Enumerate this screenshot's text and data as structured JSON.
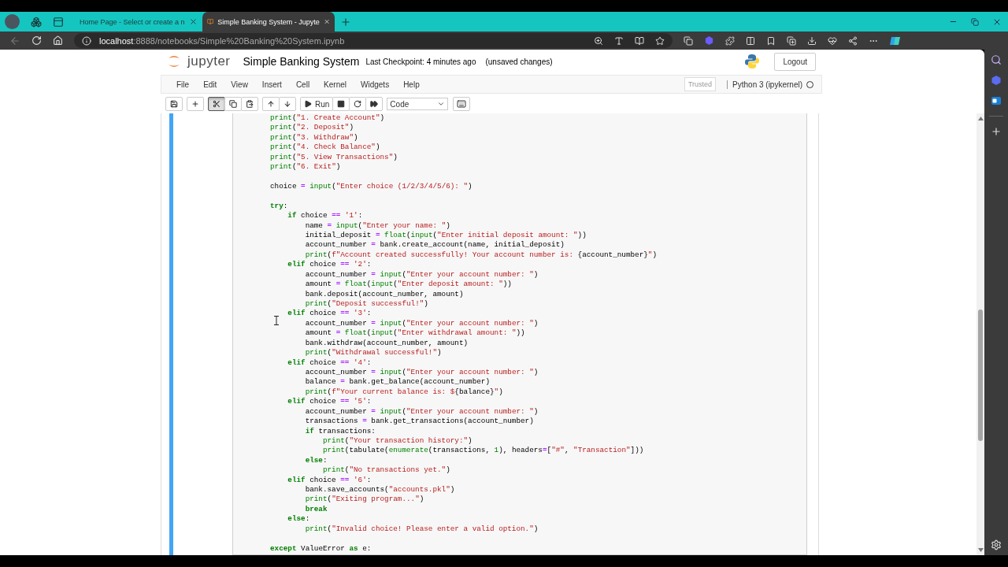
{
  "browser": {
    "tabs": [
      {
        "title": "Home Page - Select or create a n",
        "selected": false
      },
      {
        "title": "Simple Banking System - Jupyte",
        "selected": true
      }
    ],
    "url": {
      "host": "localhost",
      "path": ":8888/notebooks/Simple%20Banking%20System.ipynb"
    }
  },
  "notebook": {
    "brand": "jupyter",
    "title": "Simple Banking System",
    "checkpoint": "Last Checkpoint: 4 minutes ago",
    "status": "(unsaved changes)",
    "logout": "Logout",
    "menu": [
      "File",
      "Edit",
      "View",
      "Insert",
      "Cell",
      "Kernel",
      "Widgets",
      "Help"
    ],
    "trusted": "Trusted",
    "kernel": "Python 3 (ipykernel)",
    "kernel_busy": false,
    "toolbar": {
      "groups": [
        [
          {
            "kind": "save",
            "pressed": false
          }
        ],
        [
          {
            "kind": "add",
            "pressed": false
          }
        ],
        [
          {
            "kind": "cut",
            "pressed": true
          },
          {
            "kind": "copy",
            "pressed": false
          },
          {
            "kind": "paste",
            "pressed": false
          }
        ],
        [
          {
            "kind": "move-up",
            "pressed": false
          },
          {
            "kind": "move-down",
            "pressed": false
          }
        ],
        [
          {
            "kind": "run",
            "label": "Run",
            "pressed": false
          },
          {
            "kind": "stop",
            "pressed": false
          },
          {
            "kind": "restart",
            "pressed": false
          },
          {
            "kind": "run-all",
            "pressed": false
          }
        ]
      ],
      "cell_type": "Code",
      "after_select": [
        {
          "kind": "keyboard",
          "pressed": false
        }
      ]
    },
    "cell": {
      "selected": true,
      "lines": [
        {
          "kind": "code",
          "tokens": [
            {
              "kind": "builtin",
              "text": "print"
            },
            {
              "kind": "plain",
              "text": "("
            },
            {
              "kind": "string",
              "text": "\"1. Create Account\""
            },
            {
              "kind": "plain",
              "text": ")"
            }
          ]
        },
        {
          "kind": "code",
          "tokens": [
            {
              "kind": "builtin",
              "text": "print"
            },
            {
              "kind": "plain",
              "text": "("
            },
            {
              "kind": "string",
              "text": "\"2. Deposit\""
            },
            {
              "kind": "plain",
              "text": ")"
            }
          ]
        },
        {
          "kind": "code",
          "tokens": [
            {
              "kind": "builtin",
              "text": "print"
            },
            {
              "kind": "plain",
              "text": "("
            },
            {
              "kind": "string",
              "text": "\"3. Withdraw\""
            },
            {
              "kind": "plain",
              "text": ")"
            }
          ]
        },
        {
          "kind": "code",
          "tokens": [
            {
              "kind": "builtin",
              "text": "print"
            },
            {
              "kind": "plain",
              "text": "("
            },
            {
              "kind": "string",
              "text": "\"4. Check Balance\""
            },
            {
              "kind": "plain",
              "text": ")"
            }
          ]
        },
        {
          "kind": "code",
          "tokens": [
            {
              "kind": "builtin",
              "text": "print"
            },
            {
              "kind": "plain",
              "text": "("
            },
            {
              "kind": "string",
              "text": "\"5. View Transactions\""
            },
            {
              "kind": "plain",
              "text": ")"
            }
          ]
        },
        {
          "kind": "code",
          "tokens": [
            {
              "kind": "builtin",
              "text": "print"
            },
            {
              "kind": "plain",
              "text": "("
            },
            {
              "kind": "string",
              "text": "\"6. Exit\""
            },
            {
              "kind": "plain",
              "text": ")"
            }
          ]
        },
        {
          "kind": "blank"
        },
        {
          "kind": "code",
          "tokens": [
            {
              "kind": "plain",
              "text": "choice "
            },
            {
              "kind": "operator",
              "text": "= "
            },
            {
              "kind": "builtin",
              "text": "input"
            },
            {
              "kind": "plain",
              "text": "("
            },
            {
              "kind": "string",
              "text": "\"Enter choice (1/2/3/4/5/6): \""
            },
            {
              "kind": "plain",
              "text": ")"
            }
          ]
        },
        {
          "kind": "blank"
        },
        {
          "kind": "code",
          "tokens": [
            {
              "kind": "keyword",
              "text": "try"
            },
            {
              "kind": "plain",
              "text": ":"
            }
          ],
          "children": [
            {
              "kind": "code",
              "tokens": [
                {
                  "kind": "keyword",
                  "text": "if"
                },
                {
                  "kind": "plain",
                  "text": " choice "
                },
                {
                  "kind": "operator",
                  "text": "== "
                },
                {
                  "kind": "string",
                  "text": "'1'"
                },
                {
                  "kind": "plain",
                  "text": ":"
                }
              ],
              "children": [
                {
                  "kind": "code",
                  "tokens": [
                    {
                      "kind": "plain",
                      "text": "name "
                    },
                    {
                      "kind": "operator",
                      "text": "= "
                    },
                    {
                      "kind": "builtin",
                      "text": "input"
                    },
                    {
                      "kind": "plain",
                      "text": "("
                    },
                    {
                      "kind": "string",
                      "text": "\"Enter your name: \""
                    },
                    {
                      "kind": "plain",
                      "text": ")"
                    }
                  ]
                },
                {
                  "kind": "code",
                  "tokens": [
                    {
                      "kind": "plain",
                      "text": "initial_deposit "
                    },
                    {
                      "kind": "operator",
                      "text": "= "
                    },
                    {
                      "kind": "builtin",
                      "text": "float"
                    },
                    {
                      "kind": "plain",
                      "text": "("
                    },
                    {
                      "kind": "builtin",
                      "text": "input"
                    },
                    {
                      "kind": "plain",
                      "text": "("
                    },
                    {
                      "kind": "string",
                      "text": "\"Enter initial deposit amount: \""
                    },
                    {
                      "kind": "plain",
                      "text": "))"
                    }
                  ]
                },
                {
                  "kind": "code",
                  "tokens": [
                    {
                      "kind": "plain",
                      "text": "account_number "
                    },
                    {
                      "kind": "operator",
                      "text": "= "
                    },
                    {
                      "kind": "plain",
                      "text": "bank.create_account(name, initial_deposit)"
                    }
                  ]
                },
                {
                  "kind": "code",
                  "tokens": [
                    {
                      "kind": "builtin",
                      "text": "print"
                    },
                    {
                      "kind": "plain",
                      "text": "("
                    },
                    {
                      "kind": "string",
                      "text": "f\"Account created successfully! Your account number is: "
                    },
                    {
                      "kind": "plain",
                      "text": "{account_number}"
                    },
                    {
                      "kind": "string",
                      "text": "\""
                    },
                    {
                      "kind": "plain",
                      "text": ")"
                    }
                  ]
                }
              ]
            },
            {
              "kind": "code",
              "tokens": [
                {
                  "kind": "keyword",
                  "text": "elif"
                },
                {
                  "kind": "plain",
                  "text": " choice "
                },
                {
                  "kind": "operator",
                  "text": "== "
                },
                {
                  "kind": "string",
                  "text": "'2'"
                },
                {
                  "kind": "plain",
                  "text": ":"
                }
              ],
              "children": [
                {
                  "kind": "code",
                  "tokens": [
                    {
                      "kind": "plain",
                      "text": "account_number "
                    },
                    {
                      "kind": "operator",
                      "text": "= "
                    },
                    {
                      "kind": "builtin",
                      "text": "input"
                    },
                    {
                      "kind": "plain",
                      "text": "("
                    },
                    {
                      "kind": "string",
                      "text": "\"Enter your account number: \""
                    },
                    {
                      "kind": "plain",
                      "text": ")"
                    }
                  ]
                },
                {
                  "kind": "code",
                  "tokens": [
                    {
                      "kind": "plain",
                      "text": "amount "
                    },
                    {
                      "kind": "operator",
                      "text": "= "
                    },
                    {
                      "kind": "builtin",
                      "text": "float"
                    },
                    {
                      "kind": "plain",
                      "text": "("
                    },
                    {
                      "kind": "builtin",
                      "text": "input"
                    },
                    {
                      "kind": "plain",
                      "text": "("
                    },
                    {
                      "kind": "string",
                      "text": "\"Enter deposit amount: \""
                    },
                    {
                      "kind": "plain",
                      "text": "))"
                    }
                  ]
                },
                {
                  "kind": "code",
                  "tokens": [
                    {
                      "kind": "plain",
                      "text": "bank.deposit(account_number, amount)"
                    }
                  ]
                },
                {
                  "kind": "code",
                  "tokens": [
                    {
                      "kind": "builtin",
                      "text": "print"
                    },
                    {
                      "kind": "plain",
                      "text": "("
                    },
                    {
                      "kind": "string",
                      "text": "\"Deposit successful!\""
                    },
                    {
                      "kind": "plain",
                      "text": ")"
                    }
                  ]
                }
              ]
            },
            {
              "kind": "code",
              "tokens": [
                {
                  "kind": "keyword",
                  "text": "elif"
                },
                {
                  "kind": "plain",
                  "text": " choice "
                },
                {
                  "kind": "operator",
                  "text": "== "
                },
                {
                  "kind": "string",
                  "text": "'3'"
                },
                {
                  "kind": "plain",
                  "text": ":"
                }
              ],
              "children": [
                {
                  "kind": "code",
                  "tokens": [
                    {
                      "kind": "plain",
                      "text": "account_number "
                    },
                    {
                      "kind": "operator",
                      "text": "= "
                    },
                    {
                      "kind": "builtin",
                      "text": "input"
                    },
                    {
                      "kind": "plain",
                      "text": "("
                    },
                    {
                      "kind": "string",
                      "text": "\"Enter your account number: \""
                    },
                    {
                      "kind": "plain",
                      "text": ")"
                    }
                  ]
                },
                {
                  "kind": "code",
                  "tokens": [
                    {
                      "kind": "plain",
                      "text": "amount "
                    },
                    {
                      "kind": "operator",
                      "text": "= "
                    },
                    {
                      "kind": "builtin",
                      "text": "float"
                    },
                    {
                      "kind": "plain",
                      "text": "("
                    },
                    {
                      "kind": "builtin",
                      "text": "input"
                    },
                    {
                      "kind": "plain",
                      "text": "("
                    },
                    {
                      "kind": "string",
                      "text": "\"Enter withdrawal amount: \""
                    },
                    {
                      "kind": "plain",
                      "text": "))"
                    }
                  ]
                },
                {
                  "kind": "code",
                  "tokens": [
                    {
                      "kind": "plain",
                      "text": "bank.withdraw(account_number, amount)"
                    }
                  ]
                },
                {
                  "kind": "code",
                  "tokens": [
                    {
                      "kind": "builtin",
                      "text": "print"
                    },
                    {
                      "kind": "plain",
                      "text": "("
                    },
                    {
                      "kind": "string",
                      "text": "\"Withdrawal successful!\""
                    },
                    {
                      "kind": "plain",
                      "text": ")"
                    }
                  ]
                }
              ]
            },
            {
              "kind": "code",
              "tokens": [
                {
                  "kind": "keyword",
                  "text": "elif"
                },
                {
                  "kind": "plain",
                  "text": " choice "
                },
                {
                  "kind": "operator",
                  "text": "== "
                },
                {
                  "kind": "string",
                  "text": "'4'"
                },
                {
                  "kind": "plain",
                  "text": ":"
                }
              ],
              "children": [
                {
                  "kind": "code",
                  "tokens": [
                    {
                      "kind": "plain",
                      "text": "account_number "
                    },
                    {
                      "kind": "operator",
                      "text": "= "
                    },
                    {
                      "kind": "builtin",
                      "text": "input"
                    },
                    {
                      "kind": "plain",
                      "text": "("
                    },
                    {
                      "kind": "string",
                      "text": "\"Enter your account number: \""
                    },
                    {
                      "kind": "plain",
                      "text": ")"
                    }
                  ]
                },
                {
                  "kind": "code",
                  "tokens": [
                    {
                      "kind": "plain",
                      "text": "balance "
                    },
                    {
                      "kind": "operator",
                      "text": "= "
                    },
                    {
                      "kind": "plain",
                      "text": "bank.get_balance(account_number)"
                    }
                  ]
                },
                {
                  "kind": "code",
                  "tokens": [
                    {
                      "kind": "builtin",
                      "text": "print"
                    },
                    {
                      "kind": "plain",
                      "text": "("
                    },
                    {
                      "kind": "string",
                      "text": "f\"Your current balance is: $"
                    },
                    {
                      "kind": "plain",
                      "text": "{balance}"
                    },
                    {
                      "kind": "string",
                      "text": "\""
                    },
                    {
                      "kind": "plain",
                      "text": ")"
                    }
                  ]
                }
              ]
            },
            {
              "kind": "code",
              "tokens": [
                {
                  "kind": "keyword",
                  "text": "elif"
                },
                {
                  "kind": "plain",
                  "text": " choice "
                },
                {
                  "kind": "operator",
                  "text": "== "
                },
                {
                  "kind": "string",
                  "text": "'5'"
                },
                {
                  "kind": "plain",
                  "text": ":"
                }
              ],
              "children": [
                {
                  "kind": "code",
                  "tokens": [
                    {
                      "kind": "plain",
                      "text": "account_number "
                    },
                    {
                      "kind": "operator",
                      "text": "= "
                    },
                    {
                      "kind": "builtin",
                      "text": "input"
                    },
                    {
                      "kind": "plain",
                      "text": "("
                    },
                    {
                      "kind": "string",
                      "text": "\"Enter your account number: \""
                    },
                    {
                      "kind": "plain",
                      "text": ")"
                    }
                  ]
                },
                {
                  "kind": "code",
                  "tokens": [
                    {
                      "kind": "plain",
                      "text": "transactions "
                    },
                    {
                      "kind": "operator",
                      "text": "= "
                    },
                    {
                      "kind": "plain",
                      "text": "bank.get_transactions(account_number)"
                    }
                  ]
                },
                {
                  "kind": "code",
                  "tokens": [
                    {
                      "kind": "keyword",
                      "text": "if"
                    },
                    {
                      "kind": "plain",
                      "text": " transactions:"
                    }
                  ],
                  "children": [
                    {
                      "kind": "code",
                      "tokens": [
                        {
                          "kind": "builtin",
                          "text": "print"
                        },
                        {
                          "kind": "plain",
                          "text": "("
                        },
                        {
                          "kind": "string",
                          "text": "\"Your transaction history:\""
                        },
                        {
                          "kind": "plain",
                          "text": ")"
                        }
                      ]
                    },
                    {
                      "kind": "code",
                      "tokens": [
                        {
                          "kind": "builtin",
                          "text": "print"
                        },
                        {
                          "kind": "plain",
                          "text": "(tabulate("
                        },
                        {
                          "kind": "builtin",
                          "text": "enumerate"
                        },
                        {
                          "kind": "plain",
                          "text": "(transactions, "
                        },
                        {
                          "kind": "number",
                          "text": "1"
                        },
                        {
                          "kind": "plain",
                          "text": "), headers"
                        },
                        {
                          "kind": "operator",
                          "text": "="
                        },
                        {
                          "kind": "plain",
                          "text": "["
                        },
                        {
                          "kind": "string",
                          "text": "\"#\""
                        },
                        {
                          "kind": "plain",
                          "text": ", "
                        },
                        {
                          "kind": "string",
                          "text": "\"Transaction\""
                        },
                        {
                          "kind": "plain",
                          "text": "]))"
                        }
                      ]
                    }
                  ]
                },
                {
                  "kind": "code",
                  "tokens": [
                    {
                      "kind": "keyword",
                      "text": "else"
                    },
                    {
                      "kind": "plain",
                      "text": ":"
                    }
                  ],
                  "children": [
                    {
                      "kind": "code",
                      "tokens": [
                        {
                          "kind": "builtin",
                          "text": "print"
                        },
                        {
                          "kind": "plain",
                          "text": "("
                        },
                        {
                          "kind": "string",
                          "text": "\"No transactions yet.\""
                        },
                        {
                          "kind": "plain",
                          "text": ")"
                        }
                      ]
                    }
                  ]
                }
              ]
            },
            {
              "kind": "code",
              "tokens": [
                {
                  "kind": "keyword",
                  "text": "elif"
                },
                {
                  "kind": "plain",
                  "text": " choice "
                },
                {
                  "kind": "operator",
                  "text": "== "
                },
                {
                  "kind": "string",
                  "text": "'6'"
                },
                {
                  "kind": "plain",
                  "text": ":"
                }
              ],
              "children": [
                {
                  "kind": "code",
                  "tokens": [
                    {
                      "kind": "plain",
                      "text": "bank.save_accounts("
                    },
                    {
                      "kind": "string",
                      "text": "\"accounts.pkl\""
                    },
                    {
                      "kind": "plain",
                      "text": ")"
                    }
                  ]
                },
                {
                  "kind": "code",
                  "tokens": [
                    {
                      "kind": "builtin",
                      "text": "print"
                    },
                    {
                      "kind": "plain",
                      "text": "("
                    },
                    {
                      "kind": "string",
                      "text": "\"Exiting program...\""
                    },
                    {
                      "kind": "plain",
                      "text": ")"
                    }
                  ]
                },
                {
                  "kind": "code",
                  "tokens": [
                    {
                      "kind": "keyword",
                      "text": "break"
                    }
                  ]
                }
              ]
            },
            {
              "kind": "code",
              "tokens": [
                {
                  "kind": "keyword",
                  "text": "else"
                },
                {
                  "kind": "plain",
                  "text": ":"
                }
              ],
              "children": [
                {
                  "kind": "code",
                  "tokens": [
                    {
                      "kind": "builtin",
                      "text": "print"
                    },
                    {
                      "kind": "plain",
                      "text": "("
                    },
                    {
                      "kind": "string",
                      "text": "\"Invalid choice! Please enter a valid option.\""
                    },
                    {
                      "kind": "plain",
                      "text": ")"
                    }
                  ]
                }
              ]
            },
            {
              "kind": "blank"
            }
          ]
        },
        {
          "kind": "code",
          "tokens": [
            {
              "kind": "keyword",
              "text": "except"
            },
            {
              "kind": "plain",
              "text": " ValueError "
            },
            {
              "kind": "keyword",
              "text": "as"
            },
            {
              "kind": "plain",
              "text": " e:"
            }
          ]
        }
      ]
    }
  }
}
